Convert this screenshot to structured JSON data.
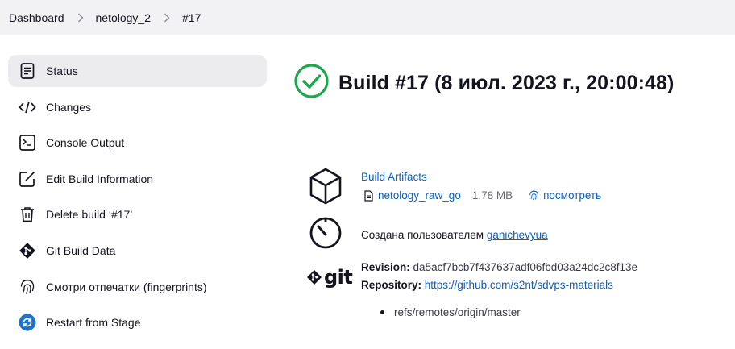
{
  "breadcrumb": {
    "items": [
      "Dashboard",
      "netology_2",
      "#17"
    ]
  },
  "sidebar": {
    "items": [
      {
        "label": "Status",
        "icon": "status-icon"
      },
      {
        "label": "Changes",
        "icon": "code-icon"
      },
      {
        "label": "Console Output",
        "icon": "terminal-icon"
      },
      {
        "label": "Edit Build Information",
        "icon": "edit-icon"
      },
      {
        "label": "Delete build ‘#17’",
        "icon": "trash-icon"
      },
      {
        "label": "Git Build Data",
        "icon": "git-icon"
      },
      {
        "label": "Смотри отпечатки (fingerprints)",
        "icon": "fingerprint-icon"
      },
      {
        "label": "Restart from Stage",
        "icon": "restart-icon"
      }
    ]
  },
  "build": {
    "title": "Build #17 (8 июл. 2023 г., 20:00:48)",
    "status_color": "#1ea64b"
  },
  "artifacts": {
    "title": "Build Artifacts",
    "file_name": "netology_raw_go",
    "file_size": "1.78 MB",
    "fingerprint_link": "посмотреть"
  },
  "created_by": {
    "prefix": "Создана пользователем ",
    "user": "ganichevyua"
  },
  "git": {
    "logo_text": "git",
    "revision_label": "Revision",
    "revision": "da5acf7bcb7f437637adf06fbd03a24dc2c8f13e",
    "repository_label": "Repository",
    "repository": "https://github.com/s2nt/sdvps-materials",
    "branches": [
      "refs/remotes/origin/master"
    ]
  },
  "colors": {
    "link": "#0b5fc1",
    "active_bg": "#ececef",
    "breadcrumb_bg": "#f2f2f4"
  }
}
